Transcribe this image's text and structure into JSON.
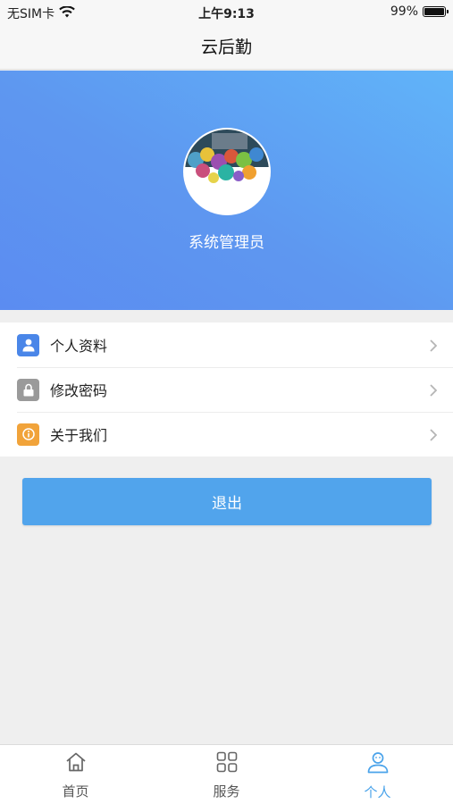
{
  "status_bar": {
    "carrier": "无SIM卡",
    "time": "上午9:13",
    "battery": "99%",
    "battery_level": 0.99
  },
  "nav": {
    "title": "云后勤"
  },
  "profile": {
    "name": "系统管理员"
  },
  "menu": {
    "items": [
      {
        "label": "个人资料",
        "icon": "person-icon",
        "color": "#4a86e8"
      },
      {
        "label": "修改密码",
        "icon": "lock-icon",
        "color": "#9a9a9a"
      },
      {
        "label": "关于我们",
        "icon": "info-icon",
        "color": "#f1a33a"
      }
    ]
  },
  "logout": {
    "label": "退出"
  },
  "tabs": [
    {
      "label": "首页",
      "icon": "home-icon",
      "active": false
    },
    {
      "label": "服务",
      "icon": "grid-icon",
      "active": false
    },
    {
      "label": "个人",
      "icon": "user-icon",
      "active": true
    }
  ],
  "colors": {
    "accent": "#4aa3ea",
    "logout_button": "#51a4ec",
    "header_gradient_start": "#60b4f9",
    "header_gradient_end": "#5b8cf1"
  }
}
